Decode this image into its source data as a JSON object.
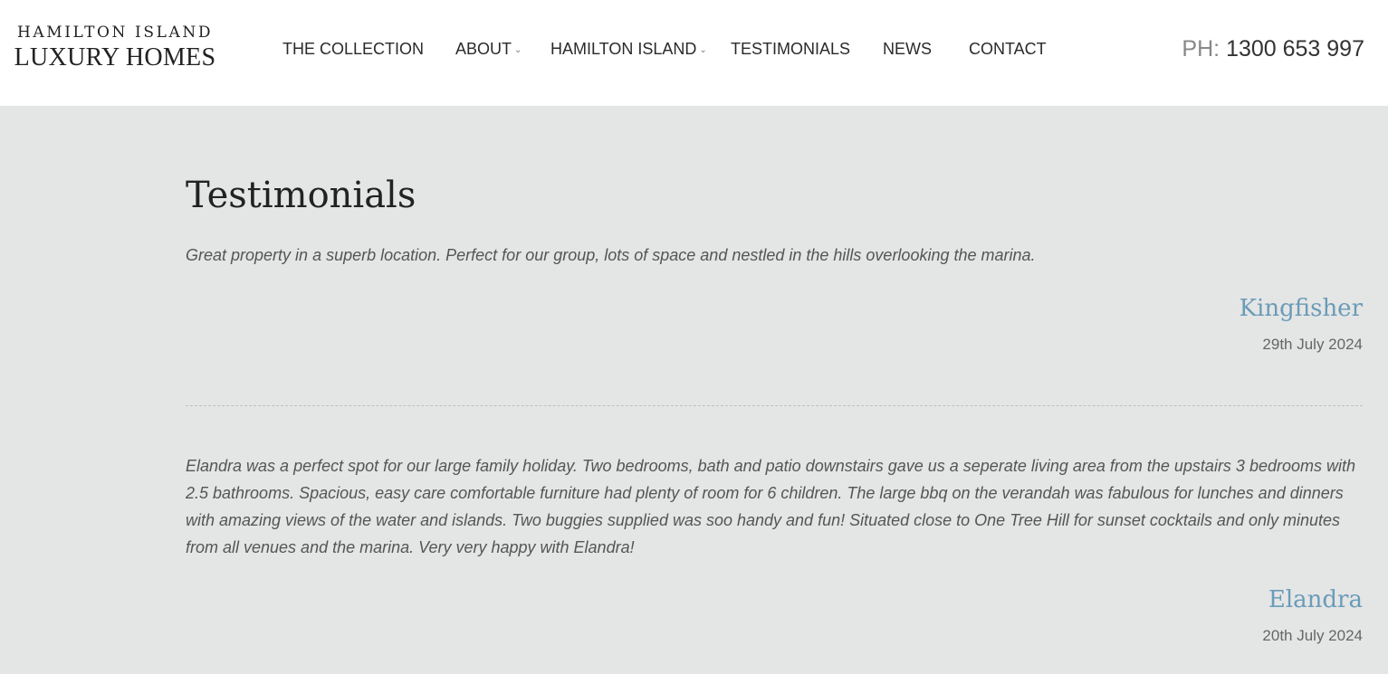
{
  "logo": {
    "top_line": "HAMILTON ISLAND",
    "bottom_line": "LUXURY HOMES"
  },
  "nav": {
    "items": [
      {
        "label": "THE COLLECTION",
        "dropdown": false
      },
      {
        "label": "ABOUT",
        "dropdown": true
      },
      {
        "label": "HAMILTON ISLAND",
        "dropdown": true
      },
      {
        "label": "TESTIMONIALS",
        "dropdown": false
      },
      {
        "label": "NEWS",
        "dropdown": false
      },
      {
        "label": "CONTACT",
        "dropdown": false
      }
    ],
    "dropdown_icon": "chevron-down-icon"
  },
  "phone": {
    "prefix": "PH:",
    "number": "1300 653 997"
  },
  "page": {
    "title": "Testimonials"
  },
  "testimonials": [
    {
      "quote": "Great property in a superb location. Perfect for our group, lots of space and nestled in the hills overlooking the marina.",
      "author": "Kingfisher",
      "date": "29th July 2024"
    },
    {
      "quote": "Elandra was a perfect spot for our large family holiday. Two bedrooms, bath and patio downstairs gave us a seperate living area from the upstairs 3 bedrooms with 2.5 bathrooms. Spacious, easy care comfortable furniture had plenty of room for 6 children. The large bbq on the verandah was fabulous for lunches and dinners with amazing views of the water and islands. Two buggies supplied was soo handy and fun! Situated close to One Tree Hill for sunset cocktails and only minutes from all venues and the marina. Very very happy with Elandra!",
      "author": "Elandra",
      "date": "20th July 2024"
    }
  ],
  "colors": {
    "background": "#e4e5e5",
    "header_background": "#ffffff",
    "author_accent": "#6a9cb8",
    "quote_text": "#555555"
  }
}
